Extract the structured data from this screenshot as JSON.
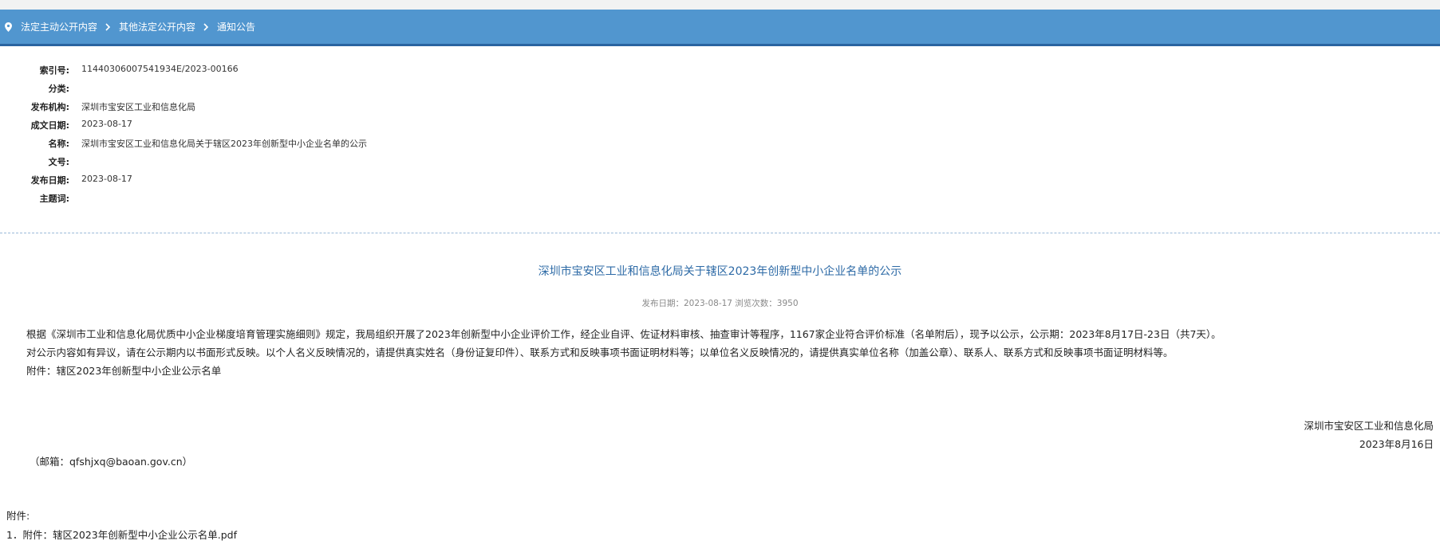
{
  "breadcrumb": {
    "items": [
      "法定主动公开内容",
      "其他法定公开内容",
      "通知公告"
    ]
  },
  "meta": {
    "rows": [
      {
        "label": "索引号:",
        "value": "11440306007541934E/2023-00166"
      },
      {
        "label": "分类:",
        "value": ""
      },
      {
        "label": "发布机构:",
        "value": "深圳市宝安区工业和信息化局"
      },
      {
        "label": "成文日期:",
        "value": "2023-08-17"
      },
      {
        "label": "名称:",
        "value": "深圳市宝安区工业和信息化局关于辖区2023年创新型中小企业名单的公示"
      },
      {
        "label": "文号:",
        "value": ""
      },
      {
        "label": "发布日期:",
        "value": "2023-08-17"
      },
      {
        "label": "主题词:",
        "value": ""
      }
    ]
  },
  "article": {
    "title": "深圳市宝安区工业和信息化局关于辖区2023年创新型中小企业名单的公示",
    "info": "发布日期：2023-08-17  浏览次数：3950",
    "paragraphs": [
      "根据《深圳市工业和信息化局优质中小企业梯度培育管理实施细则》规定，我局组织开展了2023年创新型中小企业评价工作，经企业自评、佐证材料审核、抽查审计等程序，1167家企业符合评价标准（名单附后），现予以公示，公示期：2023年8月17日-23日（共7天）。",
      "对公示内容如有异议，请在公示期内以书面形式反映。以个人名义反映情况的，请提供真实姓名（身份证复印件）、联系方式和反映事项书面证明材料等；以单位名义反映情况的，请提供真实单位名称（加盖公章）、联系人、联系方式和反映事项书面证明材料等。",
      "附件：辖区2023年创新型中小企业公示名单"
    ],
    "signature_org": "深圳市宝安区工业和信息化局",
    "signature_date": "2023年8月16日",
    "email": "（邮箱：qfshjxq@baoan.gov.cn）"
  },
  "attachments": {
    "title": "附件:",
    "items": [
      "1．附件：辖区2023年创新型中小企业公示名单.pdf"
    ]
  },
  "colors": {
    "breadcrumb_bg": "#5196cf",
    "title_blue": "#2d6aa6"
  }
}
